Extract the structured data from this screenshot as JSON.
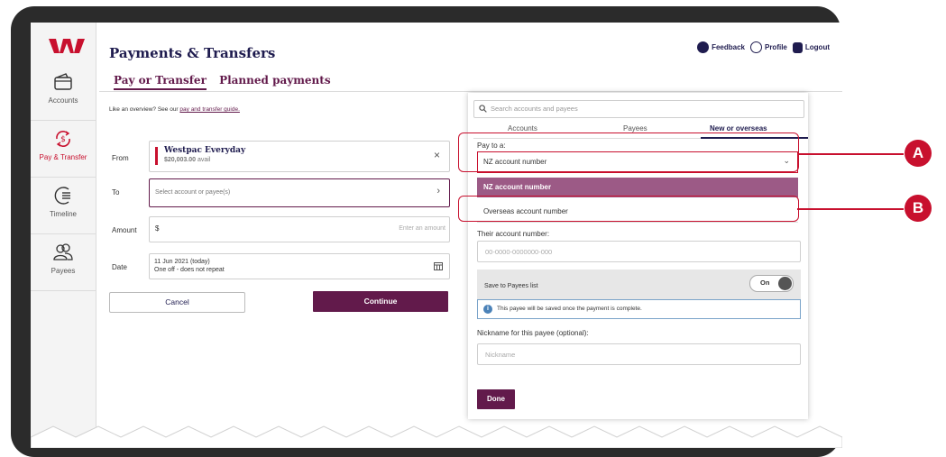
{
  "header": {
    "title": "Payments & Transfers",
    "tabs": [
      "Pay or Transfer",
      "Planned payments"
    ],
    "links": {
      "feedback": "Feedback",
      "profile": "Profile",
      "logout": "Logout"
    },
    "overview_prefix": "Like an overview? See our ",
    "overview_link": "pay and transfer guide."
  },
  "sidebar": {
    "items": [
      {
        "label": "Accounts",
        "icon": "accounts-icon"
      },
      {
        "label": "Pay & Transfer",
        "icon": "pay-transfer-icon"
      },
      {
        "label": "Timeline",
        "icon": "timeline-icon"
      },
      {
        "label": "Payees",
        "icon": "payees-icon"
      }
    ]
  },
  "form": {
    "from_label": "From",
    "from_account": "Westpac Everyday",
    "from_balance": "$20,003.00",
    "from_avail": "avail",
    "to_label": "To",
    "to_placeholder": "Select account or payee(s)",
    "amount_label": "Amount",
    "amount_symbol": "$",
    "amount_placeholder": "Enter an amount",
    "date_label": "Date",
    "date_value": "11 Jun 2021 (today)",
    "date_repeat": "One off - does not repeat",
    "cancel": "Cancel",
    "continue": "Continue"
  },
  "panel": {
    "search_placeholder": "Search accounts and payees",
    "tabs": [
      "Accounts",
      "Payees",
      "New or overseas"
    ],
    "pay_to_label": "Pay to a:",
    "pay_to_value": "NZ account number",
    "options": [
      "NZ account number",
      "Overseas account number"
    ],
    "their_account_label": "Their account number:",
    "their_account_placeholder": "00-0000-0000000-000",
    "save_label": "Save to Payees list",
    "toggle_label": "On",
    "info_text": "This payee will be saved once the payment is complete.",
    "nickname_label": "Nickname for this payee (optional):",
    "nickname_placeholder": "Nickname",
    "done": "Done"
  },
  "callouts": {
    "a": "A",
    "b": "B"
  },
  "colors": {
    "brand_red": "#c8102e",
    "plum": "#621a4b",
    "navy": "#1f1c4f"
  }
}
